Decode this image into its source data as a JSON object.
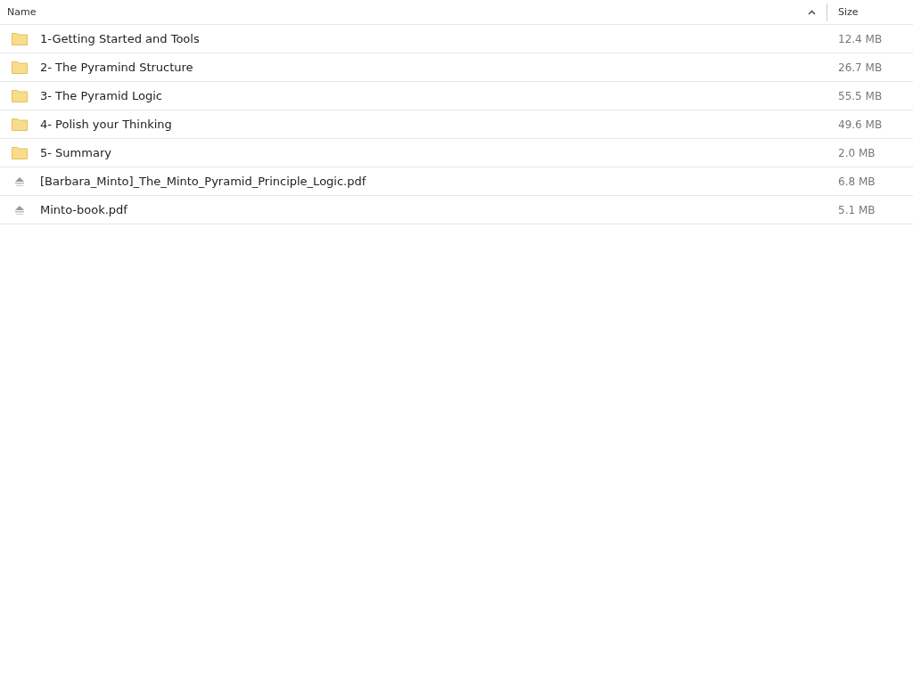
{
  "table": {
    "columns": [
      {
        "label": "Name",
        "sorted": true
      },
      {
        "label": "Size",
        "sorted": false
      }
    ],
    "rows": [
      {
        "kind": "folder",
        "name": "1-Getting Started and Tools",
        "size": "12.4 MB"
      },
      {
        "kind": "folder",
        "name": "2- The Pyramind Structure",
        "size": "26.7 MB"
      },
      {
        "kind": "folder",
        "name": "3- The Pyramid Logic",
        "size": "55.5 MB"
      },
      {
        "kind": "folder",
        "name": "4- Polish your Thinking",
        "size": "49.6 MB"
      },
      {
        "kind": "folder",
        "name": "5- Summary",
        "size": "2.0 MB"
      },
      {
        "kind": "file",
        "name": "[Barbara_Minto]_The_Minto_Pyramid_Principle_Logic.pdf",
        "size": "6.8 MB"
      },
      {
        "kind": "file",
        "name": "Minto-book.pdf",
        "size": "5.1 MB"
      }
    ]
  }
}
